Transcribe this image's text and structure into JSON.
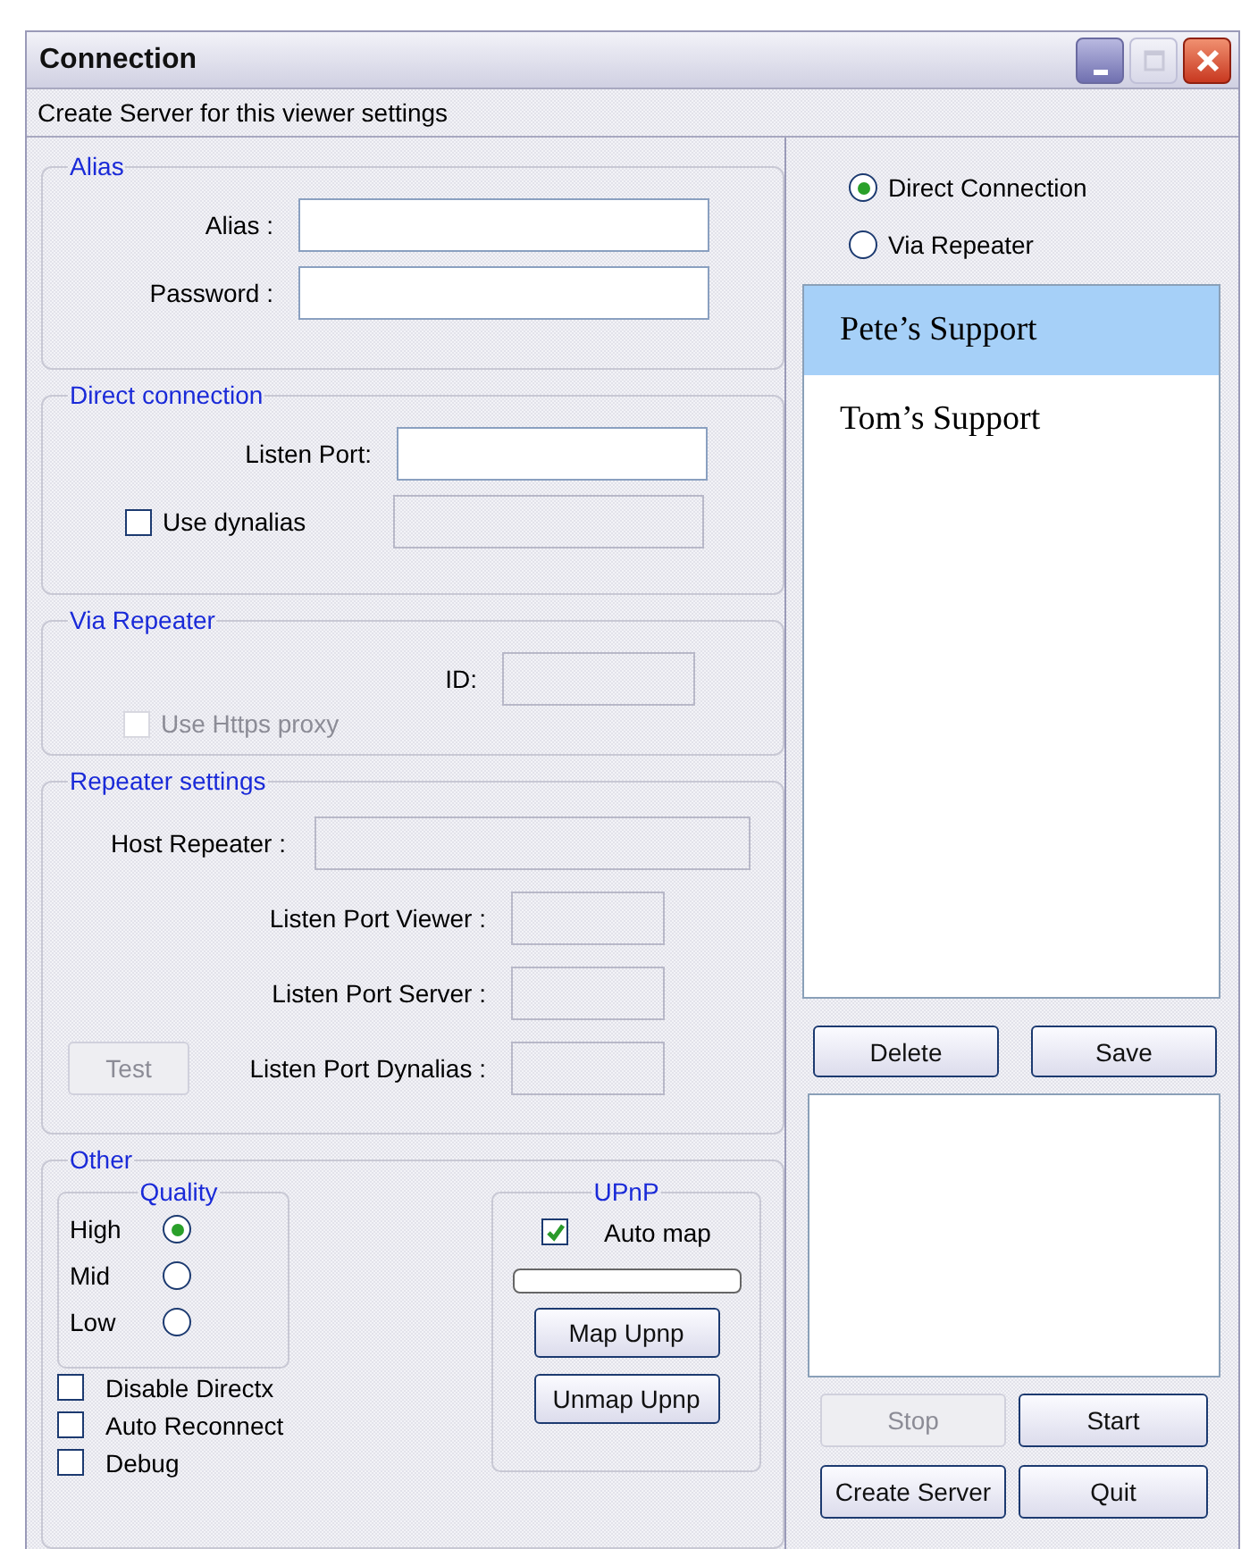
{
  "window": {
    "title": "Connection",
    "maximize_disabled": true
  },
  "subtitle": "Create Server for this viewer settings",
  "alias": {
    "title": "Alias",
    "fields": [
      {
        "label": "Alias :"
      },
      {
        "label": "Password :"
      }
    ]
  },
  "direct_connection": {
    "title": "Direct connection",
    "listen_port": {
      "label": "Listen Port:"
    },
    "use_dynalias": {
      "label": "Use dynalias",
      "checked": false,
      "disabled": false
    },
    "dynalias_field_disabled": true
  },
  "via_repeater": {
    "title": "Via Repeater",
    "id": {
      "label": "ID:",
      "disabled": true
    },
    "use_https_proxy": {
      "label": "Use Https proxy",
      "checked": false,
      "disabled": true
    }
  },
  "repeater_settings": {
    "title": "Repeater settings",
    "host_repeater": {
      "label": "Host Repeater :",
      "disabled": true
    },
    "ports": [
      {
        "label": "Listen Port Viewer :",
        "disabled": true
      },
      {
        "label": "Listen Port Server :",
        "disabled": true
      },
      {
        "label": "Listen Port Dynalias :",
        "disabled": true
      }
    ],
    "test_button": {
      "label": "Test",
      "disabled": true
    }
  },
  "other": {
    "title": "Other",
    "quality": {
      "title": "Quality",
      "options": [
        {
          "label": "High",
          "selected": true
        },
        {
          "label": "Mid",
          "selected": false
        },
        {
          "label": "Low",
          "selected": false
        }
      ]
    },
    "checkboxes": [
      {
        "label": "Disable Directx",
        "checked": false
      },
      {
        "label": "Auto Reconnect",
        "checked": false
      },
      {
        "label": "Debug",
        "checked": false
      }
    ],
    "upnp": {
      "title": "UPnP",
      "auto_map": {
        "label": "Auto map",
        "checked": true
      },
      "progress": {
        "level": 0
      },
      "buttons": [
        {
          "label": "Map Upnp"
        },
        {
          "label": "Unmap Upnp"
        }
      ]
    }
  },
  "connection_mode": [
    {
      "label": "Direct Connection",
      "selected": true
    },
    {
      "label": "Via Repeater",
      "selected": false
    }
  ],
  "servers": [
    {
      "name": "Pete’s Support",
      "selected": true
    },
    {
      "name": "Tom’s Support",
      "selected": false
    }
  ],
  "list_buttons": [
    {
      "label": "Delete",
      "disabled": false
    },
    {
      "label": "Save",
      "disabled": false
    }
  ],
  "action_buttons": [
    {
      "label": "Stop",
      "disabled": true
    },
    {
      "label": "Start",
      "disabled": false
    },
    {
      "label": "Create Server",
      "disabled": false
    },
    {
      "label": "Quit",
      "disabled": false
    }
  ]
}
